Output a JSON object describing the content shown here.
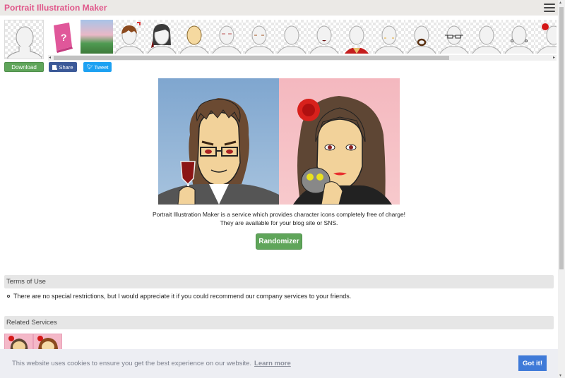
{
  "header": {
    "title": "Portrait Illustration Maker",
    "menu_icon": "hamburger-icon"
  },
  "parts": [
    {
      "name": "help",
      "icon": "help-book-icon"
    },
    {
      "name": "background"
    },
    {
      "name": "hair-front"
    },
    {
      "name": "hair-back"
    },
    {
      "name": "skin"
    },
    {
      "name": "eyebrows"
    },
    {
      "name": "eyes"
    },
    {
      "name": "nose"
    },
    {
      "name": "mouth"
    },
    {
      "name": "clothes"
    },
    {
      "name": "cheeks"
    },
    {
      "name": "beard"
    },
    {
      "name": "glasses"
    },
    {
      "name": "accessory-face"
    },
    {
      "name": "earrings"
    },
    {
      "name": "hair-accessory"
    }
  ],
  "actions": {
    "download": "Download",
    "share": "Share",
    "tweet": "Tweet"
  },
  "intro": {
    "line1": "Portrait Illustration Maker is a service which provides character icons completely free of charge!",
    "line2": "They are available for your blog site or SNS."
  },
  "randomizer": "Randomizer",
  "terms": {
    "heading": "Terms of Use",
    "items": [
      "There are no special restrictions, but I would appreciate it if you could recommend our company services to your friends."
    ]
  },
  "related": {
    "heading": "Related Services"
  },
  "cookie": {
    "text": "This website uses cookies to ensure you get the best experience on our website.",
    "link": "Learn more",
    "button": "Got it!"
  },
  "colors": {
    "brand": "#e0578a",
    "green_button": "#5fa55a",
    "facebook": "#3b5998",
    "twitter": "#1da1f2",
    "cookie_button": "#3f7ad8"
  }
}
